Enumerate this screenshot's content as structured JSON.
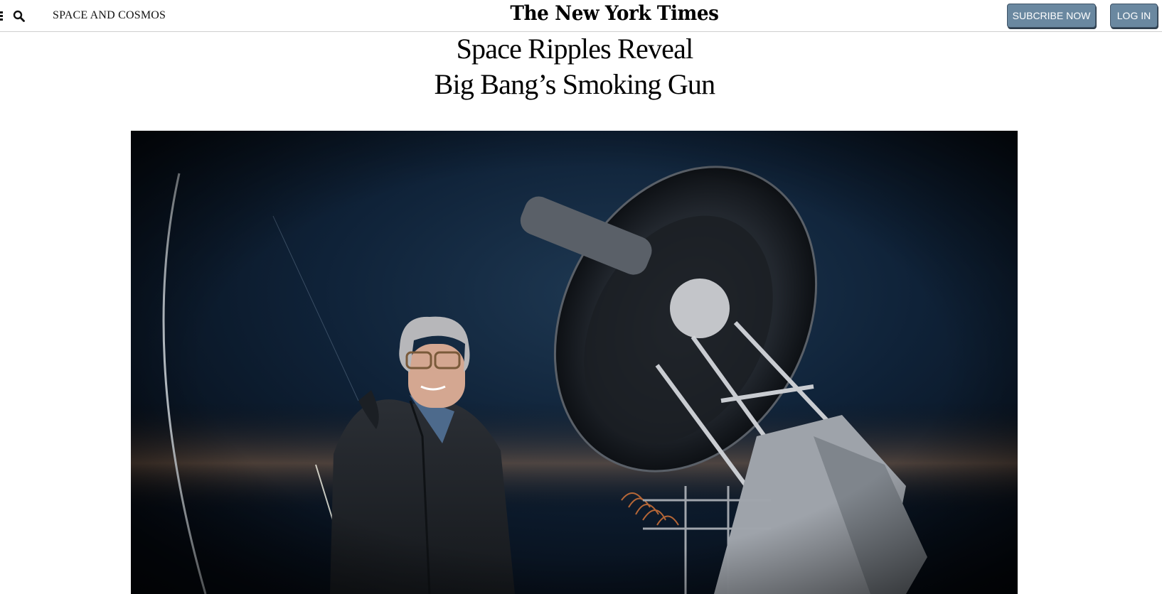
{
  "header": {
    "section": "SPACE AND COSMOS",
    "logo": "The New York Times",
    "subscribe_label": "SUBCRIBE NOW",
    "login_label": "LOG IN",
    "menu_icon": "hamburger-icon",
    "search_icon": "search-icon"
  },
  "article": {
    "headline_line1": "Space Ripples Reveal",
    "headline_line2": "Big Bang’s Smoking Gun",
    "hero_image": "photo-scientist-with-telescope"
  },
  "colors": {
    "button_bg": "#6a88a0",
    "button_border": "#3d5266",
    "hero_bg": "#0b1624"
  }
}
